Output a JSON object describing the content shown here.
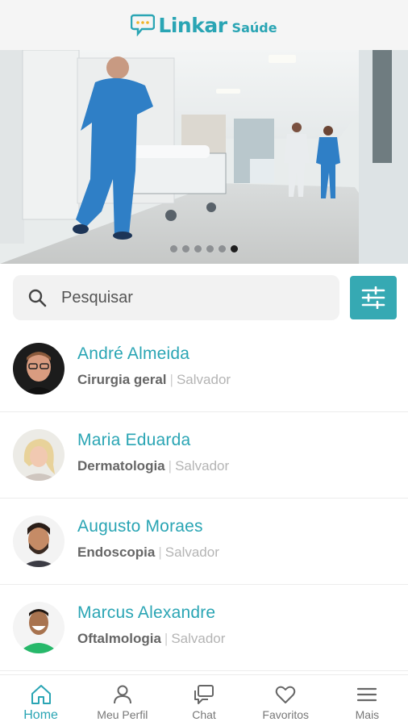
{
  "header": {
    "logo_word1": "Linkar",
    "logo_word2": "Saúde"
  },
  "banner": {
    "slide_count": 6,
    "active_slide": 6
  },
  "search": {
    "placeholder": "Pesquisar"
  },
  "doctors": [
    {
      "name": "André Almeida",
      "specialty": "Cirurgia geral",
      "separator": "|",
      "city": "Salvador"
    },
    {
      "name": "Maria Eduarda",
      "specialty": "Dermatologia",
      "separator": "|",
      "city": "Salvador"
    },
    {
      "name": "Augusto Moraes",
      "specialty": "Endoscopia",
      "separator": "|",
      "city": "Salvador"
    },
    {
      "name": "Marcus Alexandre",
      "specialty": "Oftalmologia",
      "separator": "|",
      "city": "Salvador"
    }
  ],
  "tabs": [
    {
      "label": "Home",
      "icon": "home-icon",
      "active": true
    },
    {
      "label": "Meu Perfil",
      "icon": "user-icon",
      "active": false
    },
    {
      "label": "Chat",
      "icon": "chat-icon",
      "active": false
    },
    {
      "label": "Favoritos",
      "icon": "heart-icon",
      "active": false
    },
    {
      "label": "Mais",
      "icon": "menu-icon",
      "active": false
    }
  ],
  "colors": {
    "accent": "#2aa5b4",
    "filter_button": "#36a9b3",
    "inactive": "#777777"
  }
}
